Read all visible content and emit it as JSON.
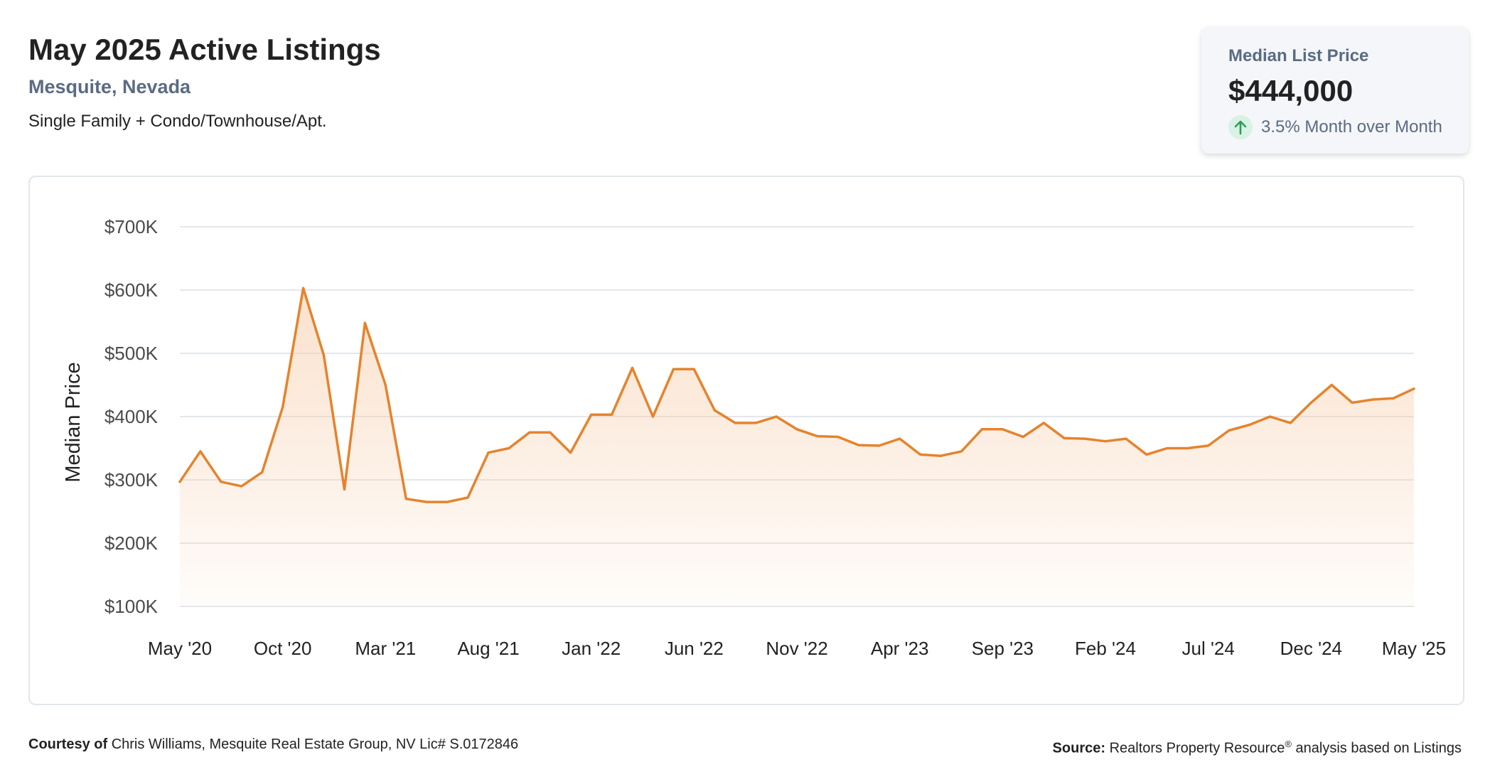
{
  "header": {
    "title": "May 2025 Active Listings",
    "location": "Mesquite, Nevada",
    "subtitle": "Single Family + Condo/Townhouse/Apt."
  },
  "kpi": {
    "label": "Median List Price",
    "value": "$444,000",
    "change_text": "3.5% Month over Month",
    "arrow_icon": "arrow-up-icon",
    "change_color": "#2e9e5b"
  },
  "footer": {
    "courtesy_label": "Courtesy of",
    "courtesy_text": "Chris Williams, Mesquite Real Estate Group, NV Lic# S.0172846",
    "source_label": "Source:",
    "source_name": "Realtors Property Resource",
    "source_mark": "®",
    "source_text": "analysis based on Listings"
  },
  "colors": {
    "line": "#e5832d",
    "fill_top": "#f6c9a3",
    "grid": "#e4e7eb",
    "axis_text": "#4a4a4a"
  },
  "chart_data": {
    "type": "area",
    "title": "",
    "xlabel": "",
    "ylabel": "Median Price",
    "ylim": [
      100000,
      700000
    ],
    "grid": true,
    "legend": "none",
    "y_ticks": [
      100000,
      200000,
      300000,
      400000,
      500000,
      600000,
      700000
    ],
    "y_tick_labels": [
      "$100K",
      "$200K",
      "$300K",
      "$400K",
      "$500K",
      "$600K",
      "$700K"
    ],
    "x_tick_labels": [
      "May '20",
      "Oct '20",
      "Mar '21",
      "Aug '21",
      "Jan '22",
      "Jun '22",
      "Nov '22",
      "Apr '23",
      "Sep '23",
      "Feb '24",
      "Jul '24",
      "Dec '24",
      "May '25"
    ],
    "x_tick_every": 5,
    "x": [
      "2020-05",
      "2020-06",
      "2020-07",
      "2020-08",
      "2020-09",
      "2020-10",
      "2020-11",
      "2020-12",
      "2021-01",
      "2021-02",
      "2021-03",
      "2021-04",
      "2021-05",
      "2021-06",
      "2021-07",
      "2021-08",
      "2021-09",
      "2021-10",
      "2021-11",
      "2021-12",
      "2022-01",
      "2022-02",
      "2022-03",
      "2022-04",
      "2022-05",
      "2022-06",
      "2022-07",
      "2022-08",
      "2022-09",
      "2022-10",
      "2022-11",
      "2022-12",
      "2023-01",
      "2023-02",
      "2023-03",
      "2023-04",
      "2023-05",
      "2023-06",
      "2023-07",
      "2023-08",
      "2023-09",
      "2023-10",
      "2023-11",
      "2023-12",
      "2024-01",
      "2024-02",
      "2024-03",
      "2024-04",
      "2024-05",
      "2024-06",
      "2024-07",
      "2024-08",
      "2024-09",
      "2024-10",
      "2024-11",
      "2024-12",
      "2025-01",
      "2025-02",
      "2025-03",
      "2025-04",
      "2025-05"
    ],
    "values": [
      297000,
      345000,
      297000,
      290000,
      312000,
      415000,
      603000,
      497000,
      285000,
      548000,
      450000,
      270000,
      265000,
      265000,
      272000,
      343000,
      350000,
      375000,
      375000,
      343000,
      403000,
      403000,
      477000,
      400000,
      475000,
      475000,
      410000,
      390000,
      390000,
      400000,
      380000,
      369000,
      368000,
      355000,
      354000,
      365000,
      340000,
      338000,
      345000,
      380000,
      380000,
      368000,
      390000,
      366000,
      365000,
      361000,
      365000,
      340000,
      350000,
      350000,
      354000,
      378000,
      387000,
      400000,
      390000,
      422000,
      450000,
      422000,
      427000,
      429000,
      444000
    ]
  }
}
